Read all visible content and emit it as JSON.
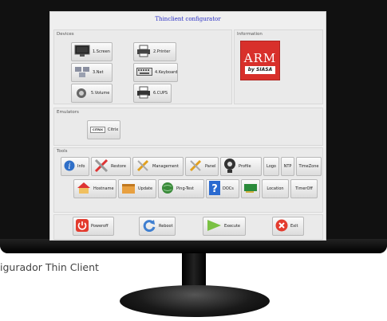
{
  "window": {
    "title": "Thinclient configurator"
  },
  "groups": {
    "devices": "Devices",
    "information": "Information",
    "emulators": "Emulators",
    "tools": "Tools"
  },
  "devices": {
    "screen": "1.Screen",
    "printer": "2.Printer",
    "net": "3.Net",
    "keyboard": "4.Keyboard",
    "volume": "5.Volume",
    "cups": "6.CUPS"
  },
  "emulators": {
    "citrix": "Citrix",
    "citrix_icon_text": "CITRIX"
  },
  "logo": {
    "name": "ARM",
    "sub": "by SIASA"
  },
  "tools": {
    "info": "Info",
    "restore": "Restore",
    "management": "Management",
    "panel": "Panel",
    "profile": "Profile",
    "logo": "Logo",
    "ntp": "NTP",
    "timezone": "TimeZone",
    "hostname": "Hostname",
    "update": "Update",
    "ping_test": "Ping-Test",
    "docs": "DOCs",
    "location": "Location",
    "timeroff": "TimerOff"
  },
  "actions": {
    "poweroff": "Poweroff",
    "reboot": "Reboot",
    "execute": "Execute",
    "exit": "Exit"
  },
  "caption": "igurador Thin Client",
  "colors": {
    "title_text": "#2a2fc4",
    "logo_bg": "#d8302b",
    "poweroff": "#e33b2e",
    "exit": "#e33b2e",
    "execute": "#7ac143",
    "reboot": "#3f7fd0"
  }
}
